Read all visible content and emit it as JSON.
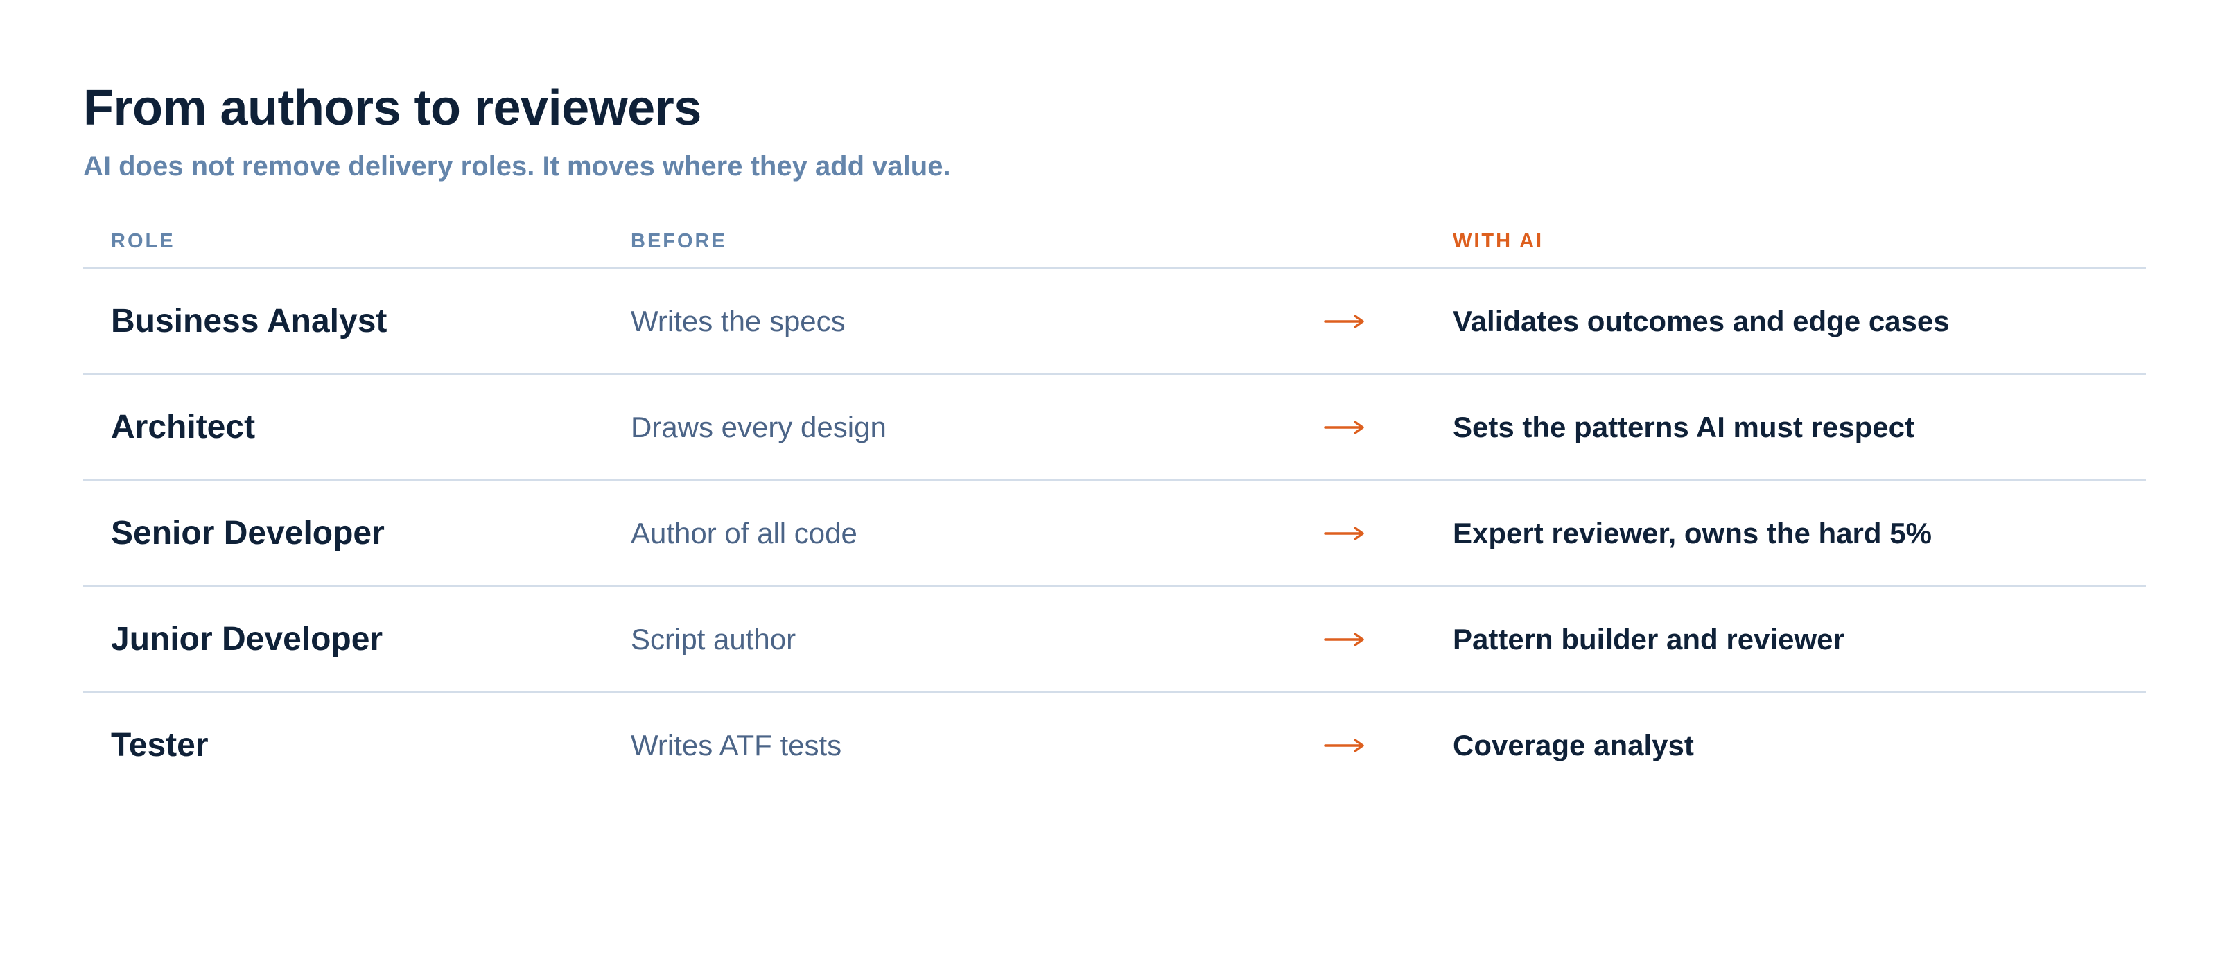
{
  "header": {
    "title": "From authors to reviewers",
    "subtitle": "AI does not remove delivery roles. It moves where they add value."
  },
  "table": {
    "columns": {
      "role": "ROLE",
      "before": "BEFORE",
      "with_ai": "WITH AI"
    },
    "rows": [
      {
        "role": "Business Analyst",
        "before": "Writes the specs",
        "with_ai": "Validates outcomes and edge cases"
      },
      {
        "role": "Architect",
        "before": "Draws every design",
        "with_ai": "Sets the patterns AI must respect"
      },
      {
        "role": "Senior Developer",
        "before": "Author of all code",
        "with_ai": "Expert reviewer, owns the hard 5%"
      },
      {
        "role": "Junior Developer",
        "before": "Script author",
        "with_ai": "Pattern builder and reviewer"
      },
      {
        "role": "Tester",
        "before": "Writes ATF tests",
        "with_ai": "Coverage analyst"
      }
    ]
  },
  "colors": {
    "heading": "#0f2138",
    "muted": "#6485ab",
    "accent": "#dd5f1e",
    "divider": "#d3dde9"
  },
  "icons": {
    "transition": "arrow-right-icon"
  }
}
